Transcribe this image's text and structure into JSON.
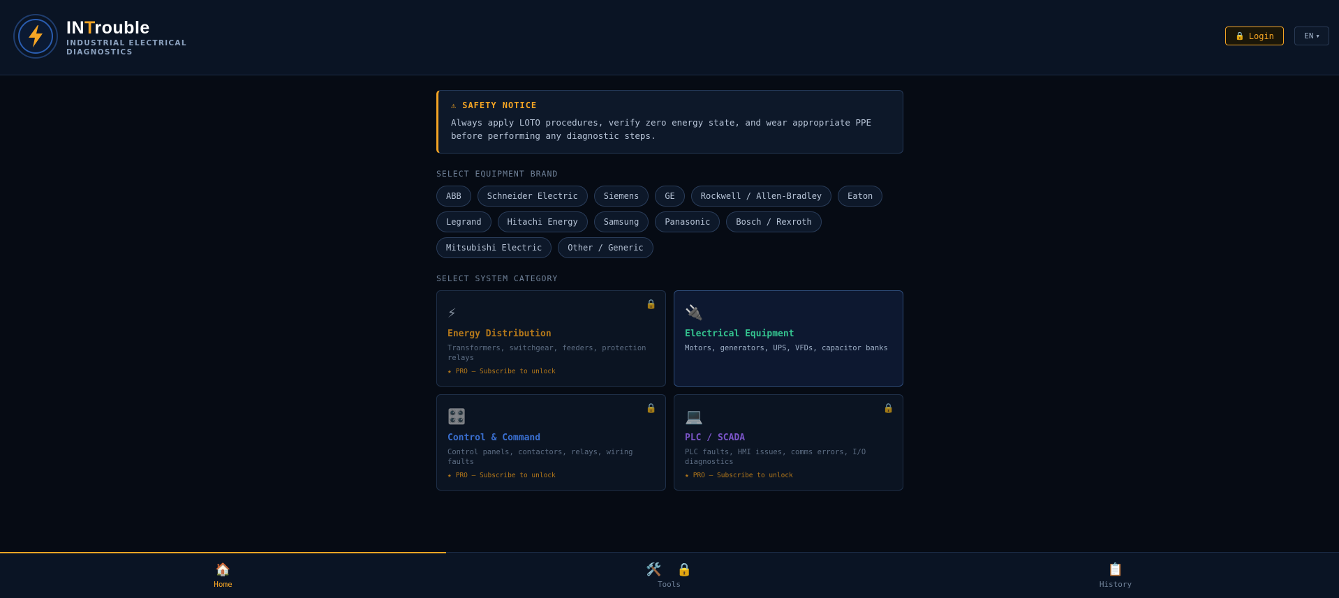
{
  "header": {
    "title_prefix": "IN",
    "title_accent": "T",
    "title_suffix": "rouble",
    "subtitle": "INDUSTRIAL ELECTRICAL DIAGNOSTICS",
    "login_label": "Login",
    "language": "EN",
    "accent_color": "#f5a524"
  },
  "safety": {
    "title": "SAFETY NOTICE",
    "text": "Always apply LOTO procedures, verify zero energy state, and wear appropriate PPE before performing any diagnostic steps."
  },
  "brands": {
    "label": "SELECT EQUIPMENT BRAND",
    "items": [
      "ABB",
      "Schneider Electric",
      "Siemens",
      "GE",
      "Rockwell / Allen-Bradley",
      "Eaton",
      "Legrand",
      "Hitachi Energy",
      "Samsung",
      "Panasonic",
      "Bosch / Rexroth",
      "Mitsubishi Electric",
      "Other / Generic"
    ]
  },
  "categories": {
    "label": "SELECT SYSTEM CATEGORY",
    "items": [
      {
        "icon": "⚡",
        "icon_name": "lightning-icon",
        "title": "Energy Distribution",
        "desc": "Transformers, switchgear, feeders, protection relays",
        "locked": true,
        "pro": "PRO — Subscribe to unlock",
        "color": "#b4781a"
      },
      {
        "icon": "🔌",
        "icon_name": "plug-icon",
        "title": "Electrical Equipment",
        "desc": "Motors, generators, UPS, VFDs, capacitor banks",
        "locked": false,
        "pro": "",
        "color": "#34c38f"
      },
      {
        "icon": "🎛️",
        "icon_name": "control-knobs-icon",
        "title": "Control & Command",
        "desc": "Control panels, contactors, relays, wiring faults",
        "locked": true,
        "pro": "PRO — Subscribe to unlock",
        "color": "#3a6fd0"
      },
      {
        "icon": "💻",
        "icon_name": "laptop-icon",
        "title": "PLC / SCADA",
        "desc": "PLC faults, HMI issues, comms errors, I/O diagnostics",
        "locked": true,
        "pro": "PRO — Subscribe to unlock",
        "color": "#7b55c9"
      }
    ]
  },
  "nav": {
    "home": {
      "icon": "🏠",
      "label": "Home"
    },
    "tools": {
      "icon": "🛠️",
      "lock": "🔒",
      "label": "Tools"
    },
    "history": {
      "icon": "📋",
      "label": "History"
    }
  }
}
